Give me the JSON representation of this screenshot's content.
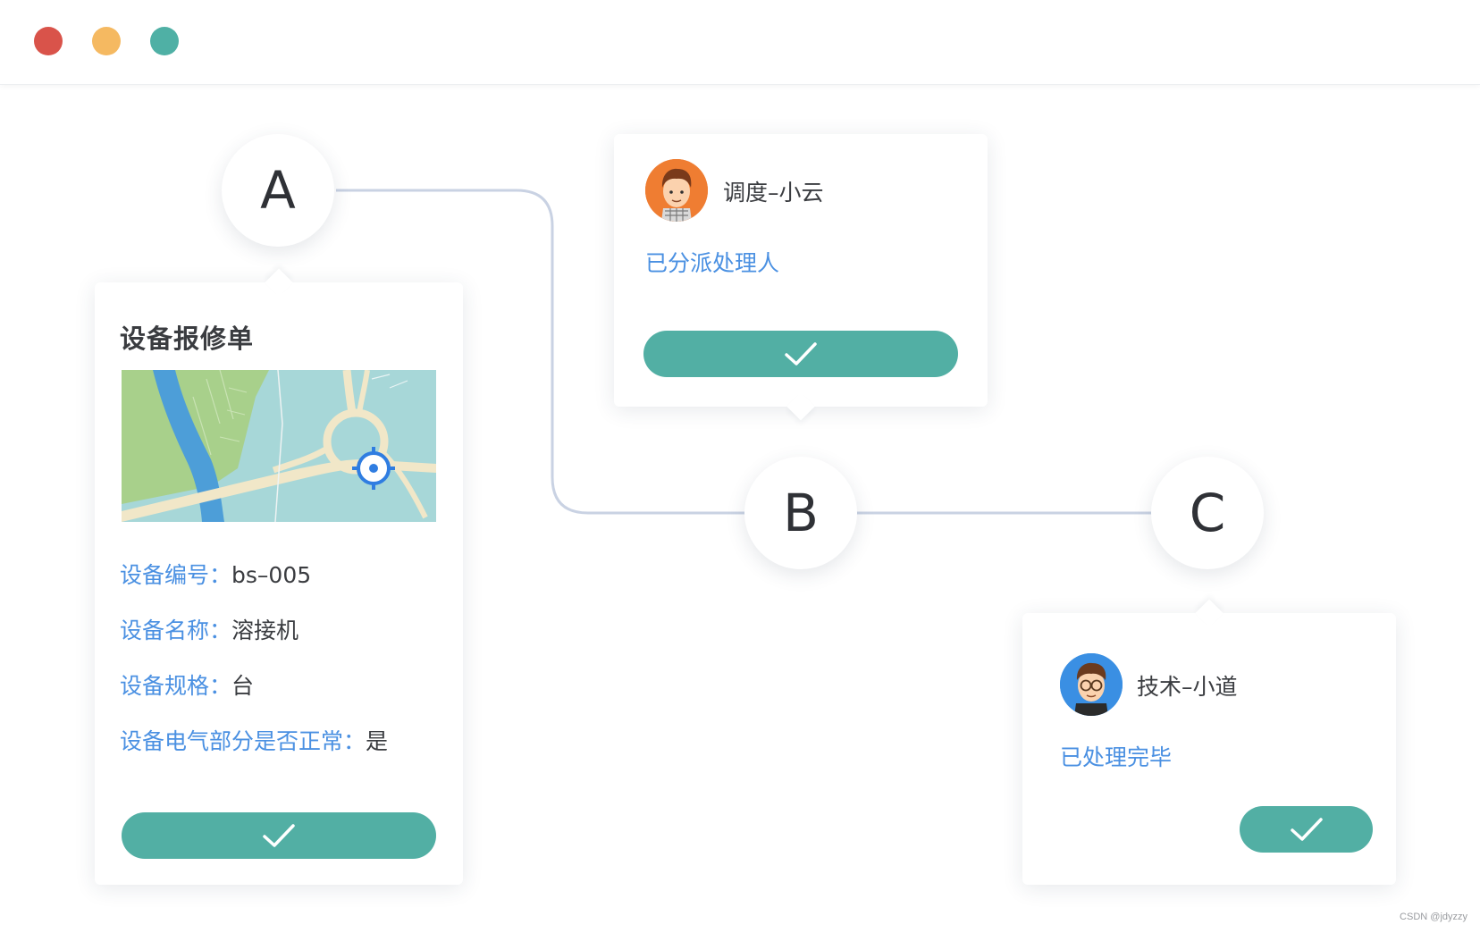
{
  "colors": {
    "traffic_red": "#d9534a",
    "traffic_yellow": "#f5b961",
    "traffic_green": "#4fb0a5",
    "accent_teal": "#52afa4",
    "label_blue": "#4a90e2",
    "connector": "#c9d2e3"
  },
  "window": {
    "buttons": [
      "close",
      "minimize",
      "zoom"
    ]
  },
  "nodes": {
    "a": "A",
    "b": "B",
    "c": "C"
  },
  "card_a": {
    "title": "设备报修单",
    "map_icons": [
      "location-target-icon"
    ],
    "fields": [
      {
        "label": "设备编号：",
        "value": "bs–005"
      },
      {
        "label": "设备名称：",
        "value": "溶接机"
      },
      {
        "label": "设备规格：",
        "value": "台"
      },
      {
        "label": "设备电气部分是否正常：",
        "value": "是"
      }
    ],
    "confirm_icon": "check-icon"
  },
  "card_b": {
    "person": "调度–小云",
    "status": "已分派处理人",
    "confirm_icon": "check-icon"
  },
  "card_c": {
    "person": "技术–小道",
    "status": "已处理完毕",
    "confirm_icon": "check-icon"
  },
  "watermark": "CSDN @jdyzzy"
}
